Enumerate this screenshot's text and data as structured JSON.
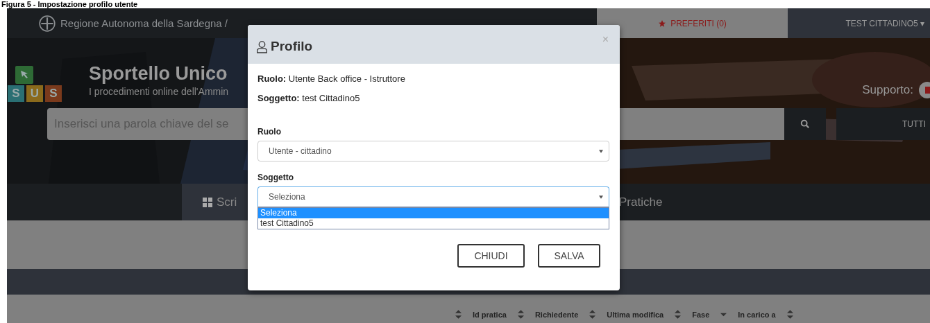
{
  "caption": "Figura 5 - Impostazione profilo utente",
  "top_bar": {
    "region": "Regione Autonoma della Sardegna /",
    "favorites": "PREFERITI (0)",
    "user": "TEST CITTADINO5 ▾"
  },
  "hero": {
    "logo_letters": [
      {
        "letter": "S",
        "color": "#2a6f73"
      },
      {
        "letter": "U",
        "color": "#8a6a1c"
      },
      {
        "letter": "S",
        "color": "#7a3a1c"
      }
    ],
    "title": "Sportello Unico",
    "subtitle": "I procedimenti online dell'Ammin",
    "support": "Supporto:",
    "search": {
      "placeholder": "Inserisci una parola chiave del se"
    },
    "filter": "TUTTI"
  },
  "nav": [
    {
      "label": "Scri",
      "selected": true
    },
    {
      "label": "Pratiche",
      "selected": false
    }
  ],
  "table": {
    "columns": [
      {
        "label": "Id pratica",
        "kind": "both"
      },
      {
        "label": "Richiedente",
        "kind": "both"
      },
      {
        "label": "Ultima modifica",
        "kind": "both"
      },
      {
        "label": "Fase",
        "kind": "desc"
      },
      {
        "label": "In carico a",
        "kind": "both"
      }
    ]
  },
  "dialog": {
    "title": "Profilo",
    "close": "×",
    "info": [
      "**Ruolo:** Utente Back office - Istruttore",
      "**Soggetto:** test Cittadino5"
    ],
    "fields": [
      {
        "label": "Ruolo",
        "value": "Utente - cittadino",
        "focused": false,
        "expanded": false
      },
      {
        "label": "Soggetto",
        "value": "Seleziona",
        "focused": true,
        "expanded": true,
        "options": [
          {
            "label": "Seleziona",
            "selected": true
          },
          {
            "label": "test Cittadino5",
            "selected": false
          }
        ]
      }
    ],
    "buttons": [
      "CHIUDI",
      "SALVA"
    ]
  }
}
